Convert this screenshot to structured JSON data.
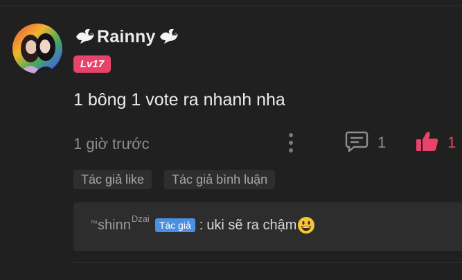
{
  "comment": {
    "username": "Rainny",
    "username_icons": [
      "dove-icon",
      "dove-icon"
    ],
    "level": "Lv17",
    "text": "1 bông 1 vote ra nhanh nha",
    "timestamp": "1 giờ trước",
    "reply_count": "1",
    "like_count": "1",
    "tags": {
      "author_liked": "Tác giả like",
      "author_replied": "Tác giả bình luận"
    }
  },
  "reply": {
    "tm_prefix": "™",
    "author": "shinn",
    "author_sup": "Dzai",
    "badge": "Tác giả",
    "separator": ":",
    "text": "uki sẽ ra chậm",
    "emoji_icon": "grinning-face-icon"
  },
  "colors": {
    "background": "#202020",
    "accent_pink": "#e8436b",
    "author_badge_blue": "#4a90e2",
    "reply_box": "#2d2d2d"
  }
}
